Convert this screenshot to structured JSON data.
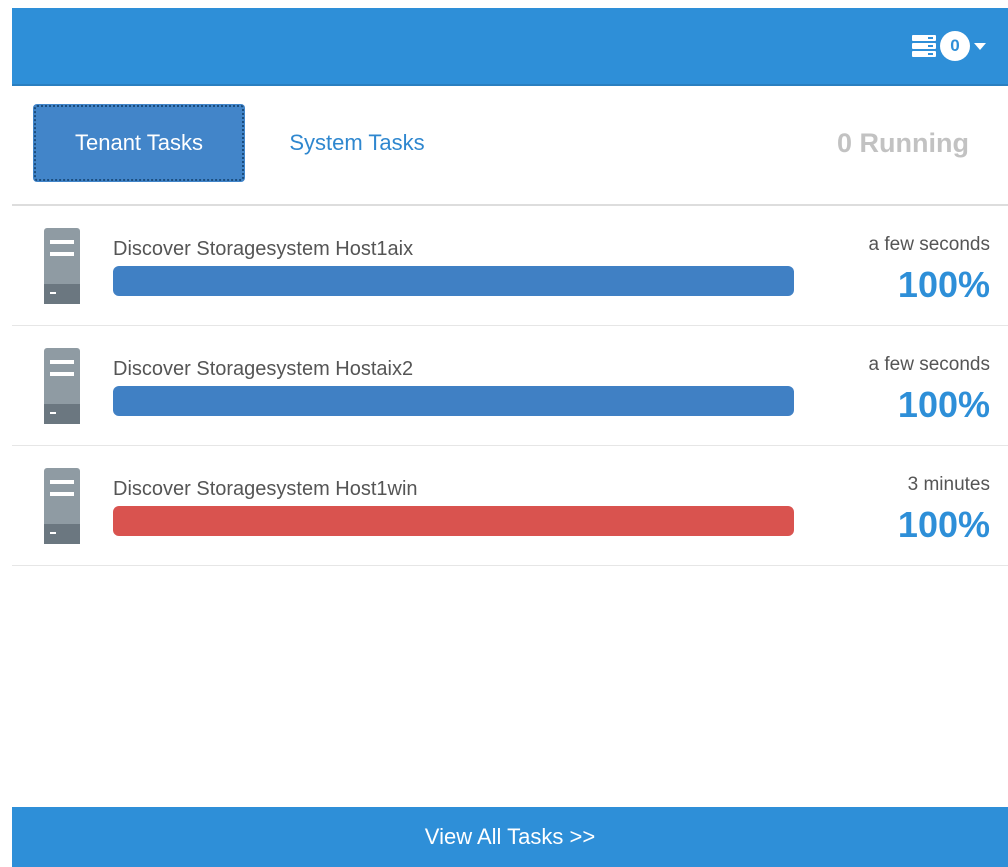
{
  "header": {
    "task_count": "0",
    "icons": [
      "server-stack-icon",
      "chevron-down-icon"
    ],
    "color": "#2e8fd8"
  },
  "tabs": [
    {
      "label": "Tenant Tasks",
      "active": true
    },
    {
      "label": "System Tasks",
      "active": false
    }
  ],
  "running_label": "0 Running",
  "tasks": [
    {
      "name": "Discover Storagesystem Host1aix",
      "time": "a few seconds",
      "progress_label": "100%",
      "progress": 1.0,
      "status_color": "#4080c4"
    },
    {
      "name": "Discover Storagesystem Hostaix2",
      "time": "a few seconds",
      "progress_label": "100%",
      "progress": 1.0,
      "status_color": "#4080c4"
    },
    {
      "name": "Discover Storagesystem Host1win",
      "time": "3 minutes",
      "progress_label": "100%",
      "progress": 1.0,
      "status_color": "#d9534f"
    }
  ],
  "footer": {
    "label": "View All Tasks >>"
  }
}
